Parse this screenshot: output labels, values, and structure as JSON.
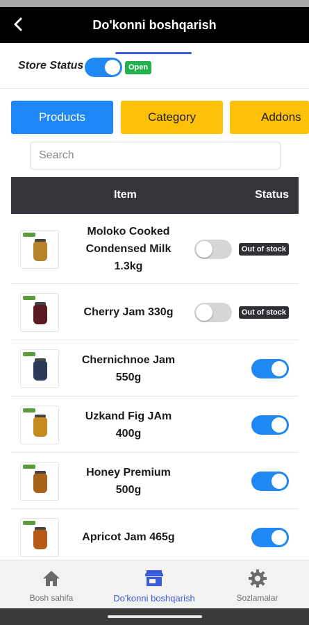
{
  "header": {
    "title": "Do'konni boshqarish",
    "back_icon": "chevron-left-icon"
  },
  "store": {
    "label": "Store Status",
    "toggle_on": true,
    "badge": "Open"
  },
  "tabs": [
    {
      "label": "Products",
      "active": true
    },
    {
      "label": "Category",
      "active": false
    },
    {
      "label": "Addons",
      "active": false
    }
  ],
  "search": {
    "placeholder": "Search",
    "value": ""
  },
  "table": {
    "headers": {
      "item": "Item",
      "status": "Status"
    },
    "rows": [
      {
        "name_lines": [
          "Moloko Cooked",
          "Condensed Milk",
          "1.3kg"
        ],
        "in_stock": false,
        "badge": "Out of stock"
      },
      {
        "name_lines": [
          "Cherry Jam 330g"
        ],
        "in_stock": false,
        "badge": "Out of stock"
      },
      {
        "name_lines": [
          "Chernichnoe Jam",
          "550g"
        ],
        "in_stock": true,
        "badge": ""
      },
      {
        "name_lines": [
          "Uzkand Fig JAm",
          "400g"
        ],
        "in_stock": true,
        "badge": ""
      },
      {
        "name_lines": [
          "Honey Premium",
          "500g"
        ],
        "in_stock": true,
        "badge": ""
      },
      {
        "name_lines": [
          "Apricot Jam 465g"
        ],
        "in_stock": true,
        "badge": ""
      }
    ]
  },
  "bottom_nav": [
    {
      "label": "Bosh sahifa",
      "icon": "home-icon",
      "active": false
    },
    {
      "label": "Do'konni boshqarish",
      "icon": "store-icon",
      "active": true
    },
    {
      "label": "Sozlamalar",
      "icon": "gear-icon",
      "active": false
    }
  ],
  "colors": {
    "accent": "#1f88f2",
    "tab_inactive": "#ffc107",
    "header": "#000000",
    "open_badge": "#22b14c",
    "nav_active": "#3b5bdb"
  }
}
